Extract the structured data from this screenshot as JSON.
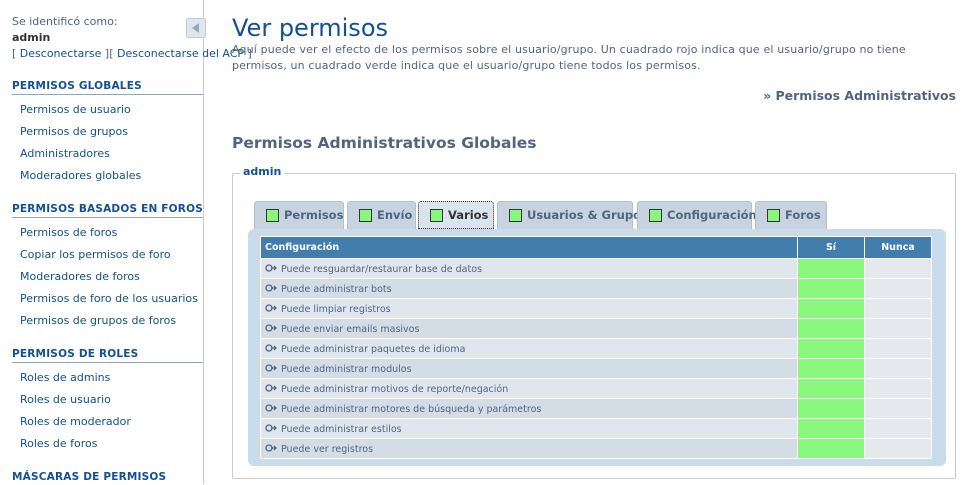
{
  "sidebar": {
    "login_text": "Se identificó como:",
    "username": "admin",
    "logout": "Desconectarse",
    "logout_acp": "Desconectarse del ACP",
    "sections": [
      {
        "title": "PERMISOS GLOBALES",
        "items": [
          "Permisos de usuario",
          "Permisos de grupos",
          "Administradores",
          "Moderadores globales"
        ]
      },
      {
        "title": "PERMISOS BASADOS EN FOROS",
        "items": [
          "Permisos de foros",
          "Copiar los permisos de foro",
          "Moderadores de foros",
          "Permisos de foro de los usuarios",
          "Permisos de grupos de foros"
        ]
      },
      {
        "title": "PERMISOS DE ROLES",
        "items": [
          "Roles de admins",
          "Roles de usuario",
          "Roles de moderador",
          "Roles de foros"
        ]
      },
      {
        "title": "MÁSCARAS DE PERMISOS",
        "items": []
      }
    ]
  },
  "main": {
    "title": "Ver permisos",
    "description": "Aquí puede ver el efecto de los permisos sobre el usuario/grupo. Un cuadrado rojo indica que el usuario/grupo no tiene permisos, un cuadrado verde indica que el usuario/grupo tiene todos los permisos.",
    "admin_link": "» Permisos Administrativos",
    "section_title": "Permisos Administrativos Globales",
    "legend": "admin",
    "tabs": [
      "Permisos",
      "Envío",
      "Varios",
      "Usuarios & Grupos",
      "Configuración",
      "Foros"
    ],
    "active_tab": "Varios",
    "table": {
      "headers": [
        "Configuración",
        "Sí",
        "Nunca"
      ],
      "rows": [
        "Puede resguardar/restaurar base de datos",
        "Puede administrar bots",
        "Puede limpiar registros",
        "Puede enviar emails masivos",
        "Puede administrar paquetes de idioma",
        "Puede administrar modulos",
        "Puede administrar motivos de reporte/negación",
        "Puede administrar motores de búsqueda y parámetros",
        "Puede administrar estilos",
        "Puede ver registros"
      ]
    }
  },
  "colors": {
    "yes": "#8af87f",
    "header": "#417eae",
    "link": "#105289"
  }
}
